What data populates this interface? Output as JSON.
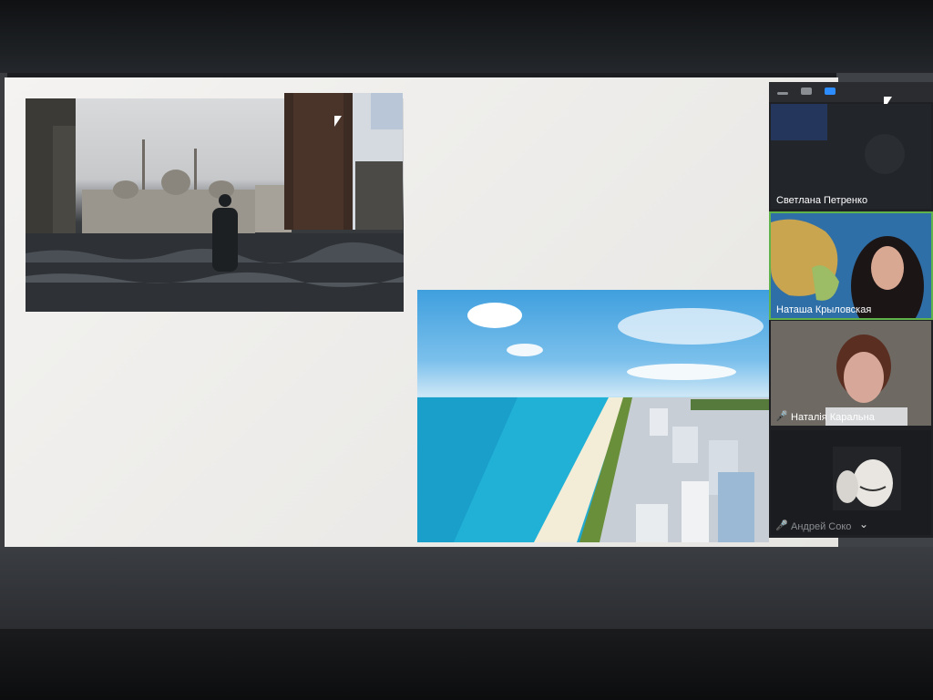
{
  "participants": [
    {
      "name": "Светлана Петренко",
      "muted": false,
      "speaking": false
    },
    {
      "name": "Наташа Крыловская",
      "muted": false,
      "speaking": true
    },
    {
      "name": "Наталія Каральна",
      "muted": true,
      "speaking": false
    },
    {
      "name": "Андрей Соко",
      "muted": true,
      "speaking": false
    }
  ],
  "icons": {
    "minimize": "minimize-icon",
    "view": "view-icon",
    "gallery": "gallery-view-icon",
    "mute": "mic-muted-icon",
    "expand": "chevron-down-icon"
  },
  "colors": {
    "speaking_border": "#5fb34a",
    "mute_red": "#e23b3b",
    "gallery_blue": "#2d8cff"
  }
}
